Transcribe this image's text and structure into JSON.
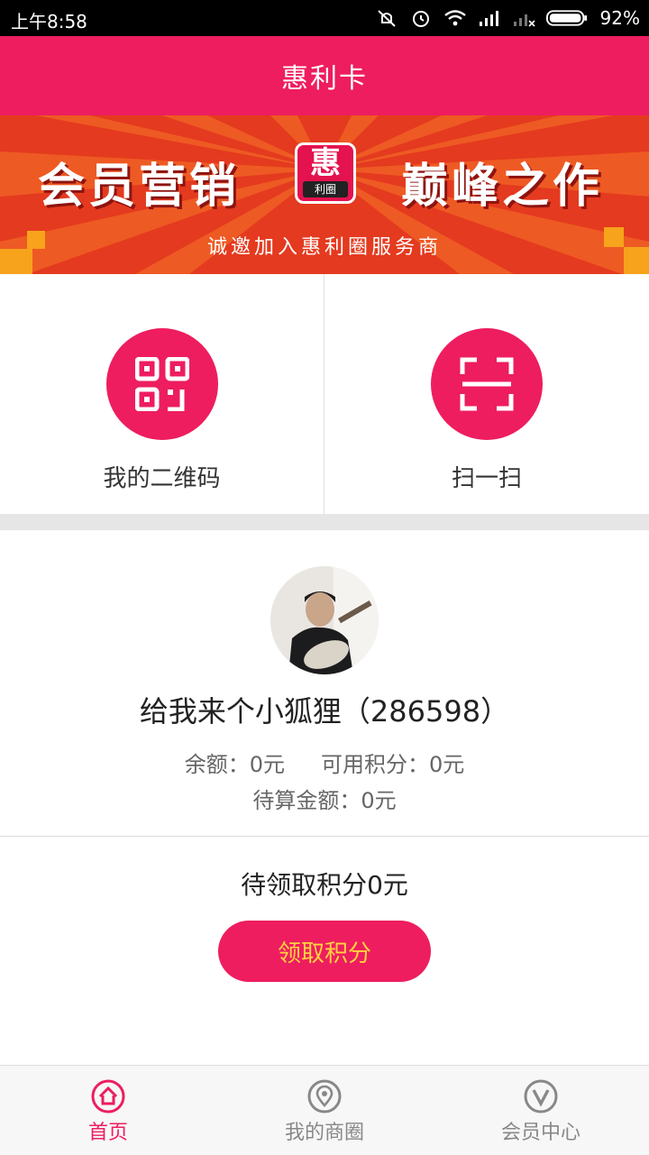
{
  "status_bar": {
    "time": "上午8:58",
    "battery": "92%"
  },
  "app_bar": {
    "title": "惠利卡"
  },
  "banner": {
    "left_text": "会员营销",
    "right_text": "巅峰之作",
    "logo_main": "惠",
    "logo_sub": "利圈",
    "subtitle": "诚邀加入惠利圈服务商"
  },
  "actions": [
    {
      "label": "我的二维码",
      "icon": "qr-code-icon"
    },
    {
      "label": "扫一扫",
      "icon": "scan-icon"
    }
  ],
  "profile": {
    "name": "给我来个小狐狸（286598）",
    "balance": "余额：0元",
    "points": "可用积分：0元",
    "pending_amount": "待算金额：0元"
  },
  "points": {
    "pending_text": "待领取积分0元",
    "claim_button": "领取积分"
  },
  "nav": [
    {
      "label": "首页",
      "icon": "home-icon",
      "active": true
    },
    {
      "label": "我的商圈",
      "icon": "location-pin-icon",
      "active": false
    },
    {
      "label": "会员中心",
      "icon": "vip-icon",
      "active": false
    }
  ],
  "colors": {
    "primary": "#ee1d5f",
    "button_text": "#ffd23f",
    "banner_bg": "#e43a1f",
    "accent_squares": "#f7a31b"
  }
}
